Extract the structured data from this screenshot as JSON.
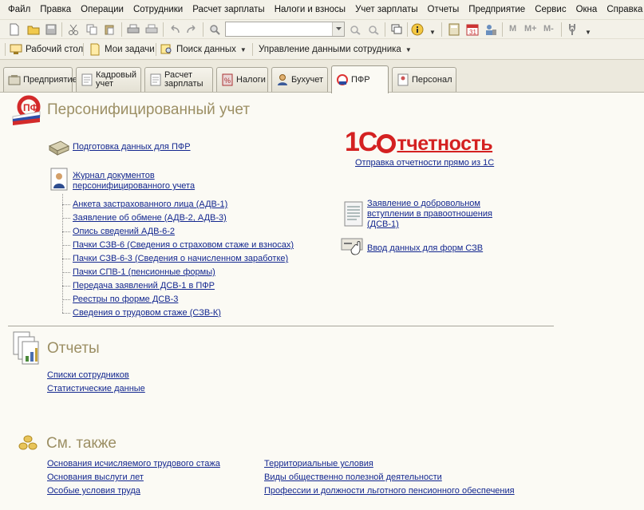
{
  "menu": [
    "Файл",
    "Правка",
    "Операции",
    "Сотрудники",
    "Расчет зарплаты",
    "Налоги и взносы",
    "Учет зарплаты",
    "Отчеты",
    "Предприятие",
    "Сервис",
    "Окна",
    "Справка"
  ],
  "toolbar": {
    "search_value": "",
    "m_labels": [
      "M",
      "M+",
      "M-"
    ]
  },
  "panel": {
    "desktop": "Рабочий стол",
    "tasks": "Мои задачи",
    "search": "Поиск данных",
    "employee_data": "Управление данными сотрудника"
  },
  "tabs": [
    {
      "label": "Предприятие"
    },
    {
      "label1": "Кадровый",
      "label2": "учет"
    },
    {
      "label1": "Расчет",
      "label2": "зарплаты"
    },
    {
      "label": "Налоги"
    },
    {
      "label": "Бухучет"
    },
    {
      "label": "ПФР"
    },
    {
      "label": "Персонал"
    }
  ],
  "sections": {
    "personified": {
      "title": "Персонифицированный учет",
      "prep": "Подготовка данных для ПФР",
      "journal1": "Журнал документов",
      "journal2": "персонифицированного учета",
      "docs": [
        "Анкета застрахованного лица (АДВ-1)",
        "Заявление об обмене (АДВ-2, АДВ-3)",
        "Опись сведений АДВ-6-2",
        "Пачки СЗВ-6 (Сведения о страховом стаже и взносах)",
        "Пачки СЗВ-6-3 (Сведения о начисленном заработке)",
        "Пачки СПВ-1 (пенсионные формы)",
        "Передача заявлений ДСВ-1 в ПФР",
        "Реестры по форме ДСВ-3",
        "Сведения о трудовом стаже (СЗВ-К)"
      ],
      "logo_big": "1С",
      "logo_word": "тчетность",
      "reporting_link": "Отправка отчетности прямо из 1С",
      "dsv1_l1": "Заявление о добровольном",
      "dsv1_l2": "вступлении в правоотношения",
      "dsv1_l3": "(ДСВ-1)",
      "szv_input": "Ввод данных для форм СЗВ"
    },
    "reports": {
      "title": "Отчеты",
      "items": [
        "Списки сотрудников",
        "Статистические данные"
      ]
    },
    "see_also": {
      "title": "См. также",
      "left": [
        "Основания исчисляемого трудового стажа",
        "Основания выслуги лет",
        "Особые условия труда"
      ],
      "right": [
        "Территориальные условия",
        "Виды общественно полезной деятельности",
        "Профессии и должности льготного пенсионного обеспечения"
      ]
    }
  },
  "colors": {
    "link": "#13278f",
    "section_title": "#9c8f64",
    "logo_red": "#d42121"
  }
}
